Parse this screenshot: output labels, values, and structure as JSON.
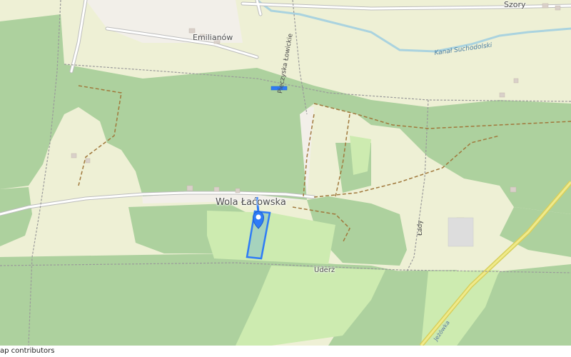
{
  "map": {
    "labels": {
      "village_main": "Wola Łaćowska",
      "village_north": "Emilianów",
      "village_ne": "Szory",
      "canal": "Kanał Suchodolski",
      "road_piecz": "Pieczyska Łowickie",
      "road_lady": "Łady",
      "place_uderz": "Uderz",
      "road_se": "Jeżówka"
    },
    "colors": {
      "forest": "#add19e",
      "meadow": "#cdebb0",
      "farmland": "#eef0d5",
      "background": "#f2efe9",
      "road": "#ffffff",
      "water": "#aad3df",
      "railway": "#e8e27a",
      "parcel_outline": "#2e7cf6",
      "parcel_fill": "#9fcfbf"
    },
    "marker": {
      "icon": "map-pin-icon"
    }
  },
  "attribution": {
    "text": "ap contributors"
  }
}
